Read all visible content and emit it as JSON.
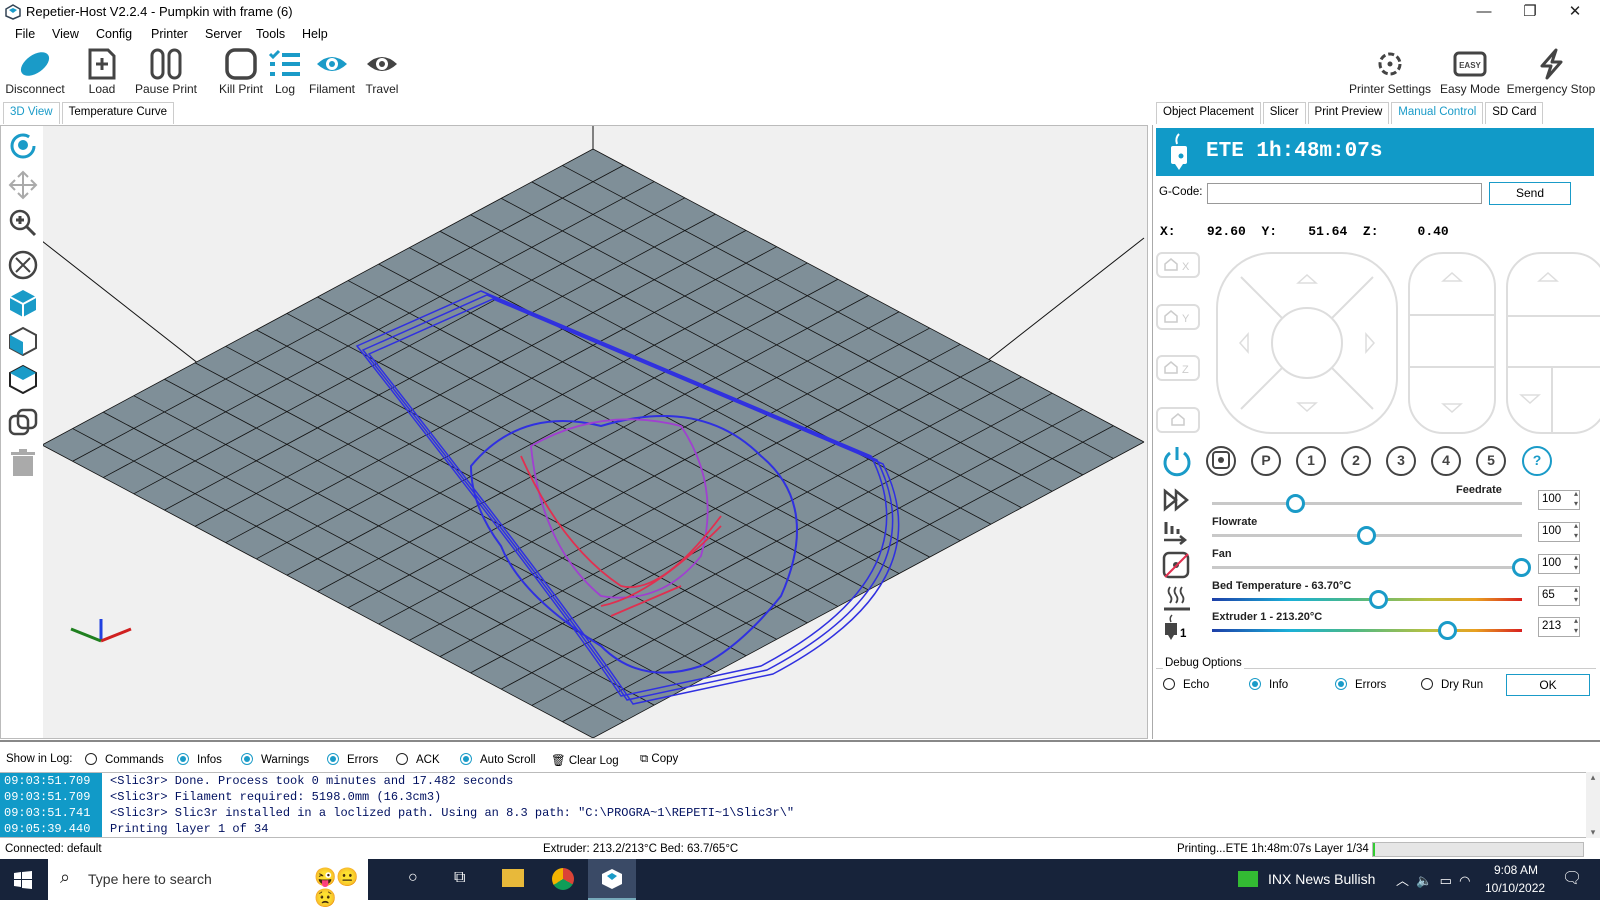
{
  "window": {
    "title": "Repetier-Host V2.2.4 - Pumpkin with frame (6)"
  },
  "menu": [
    "File",
    "View",
    "Config",
    "Printer",
    "Server",
    "Tools",
    "Help"
  ],
  "toolbar": {
    "disconnect": "Disconnect",
    "load": "Load",
    "pause": "Pause Print",
    "kill": "Kill Print",
    "log": "Log",
    "filament": "Filament",
    "travel": "Travel",
    "printer_settings": "Printer Settings",
    "easy_mode": "Easy Mode",
    "easy_badge": "EASY",
    "emergency": "Emergency Stop"
  },
  "left_tabs": [
    "3D View",
    "Temperature Curve"
  ],
  "right_tabs": [
    "Object Placement",
    "Slicer",
    "Print Preview",
    "Manual Control",
    "SD Card"
  ],
  "manual": {
    "ete": "ETE 1h:48m:07s",
    "gcode_label": "G-Code:",
    "gcode_value": "",
    "send": "Send",
    "x_label": "X:",
    "x": "92.60",
    "y_label": "Y:",
    "y": "51.64",
    "z_label": "Z:",
    "z": "0.40",
    "home": [
      "X",
      "Y",
      "Z",
      ""
    ],
    "circles": [
      "P",
      "1",
      "2",
      "3",
      "4",
      "5",
      "?"
    ],
    "sliders": [
      {
        "label": "Feedrate",
        "value": "100",
        "level": 0.27,
        "temp": false
      },
      {
        "label": "Flowrate",
        "value": "100",
        "level": 0.5,
        "temp": false
      },
      {
        "label": "Fan",
        "value": "100",
        "level": 1.0,
        "temp": false
      },
      {
        "label": "Bed Temperature - 63.70°C",
        "value": "65",
        "level": 0.54,
        "temp": true
      },
      {
        "label": "Extruder 1 - 213.20°C",
        "value": "213",
        "level": 0.76,
        "temp": true
      }
    ],
    "extruder_num": "1",
    "debug_title": "Debug Options",
    "debug": [
      {
        "label": "Echo",
        "on": false
      },
      {
        "label": "Info",
        "on": true
      },
      {
        "label": "Errors",
        "on": true
      },
      {
        "label": "Dry Run",
        "on": false
      }
    ],
    "ok": "OK"
  },
  "log": {
    "show_label": "Show in Log:",
    "options": [
      {
        "label": "Commands",
        "on": false
      },
      {
        "label": "Infos",
        "on": true
      },
      {
        "label": "Warnings",
        "on": true
      },
      {
        "label": "Errors",
        "on": true
      },
      {
        "label": "ACK",
        "on": false
      },
      {
        "label": "Auto Scroll",
        "on": true
      }
    ],
    "clear": "Clear Log",
    "copy": "Copy",
    "lines": [
      {
        "ts": "09:03:51.709",
        "msg": "<Slic3r> Done. Process took 0 minutes and 17.482 seconds"
      },
      {
        "ts": "09:03:51.709",
        "msg": "<Slic3r> Filament required: 5198.0mm (16.3cm3)"
      },
      {
        "ts": "09:03:51.741",
        "msg": "<Slic3r> Slic3r installed in a loclized path. Using an 8.3 path: \"C:\\PROGRA~1\\REPETI~1\\Slic3r\\\""
      },
      {
        "ts": "09:05:39.440",
        "msg": "Printing layer 1 of 34"
      }
    ]
  },
  "status": {
    "connected": "Connected: default",
    "temps": "Extruder: 213.2/213°C Bed: 63.7/65°C",
    "printing": "Printing...ETE 1h:48m:07s Layer 1/34",
    "progress": 0.005
  },
  "taskbar": {
    "search": "Type here to search",
    "stock": "INX  News Bullish",
    "time": "9:08 AM",
    "date": "10/10/2022"
  },
  "colors": {
    "accent": "#119ac8",
    "plate": "#7f8f98",
    "model_blue": "#3030e0",
    "model_red": "#e03050"
  }
}
